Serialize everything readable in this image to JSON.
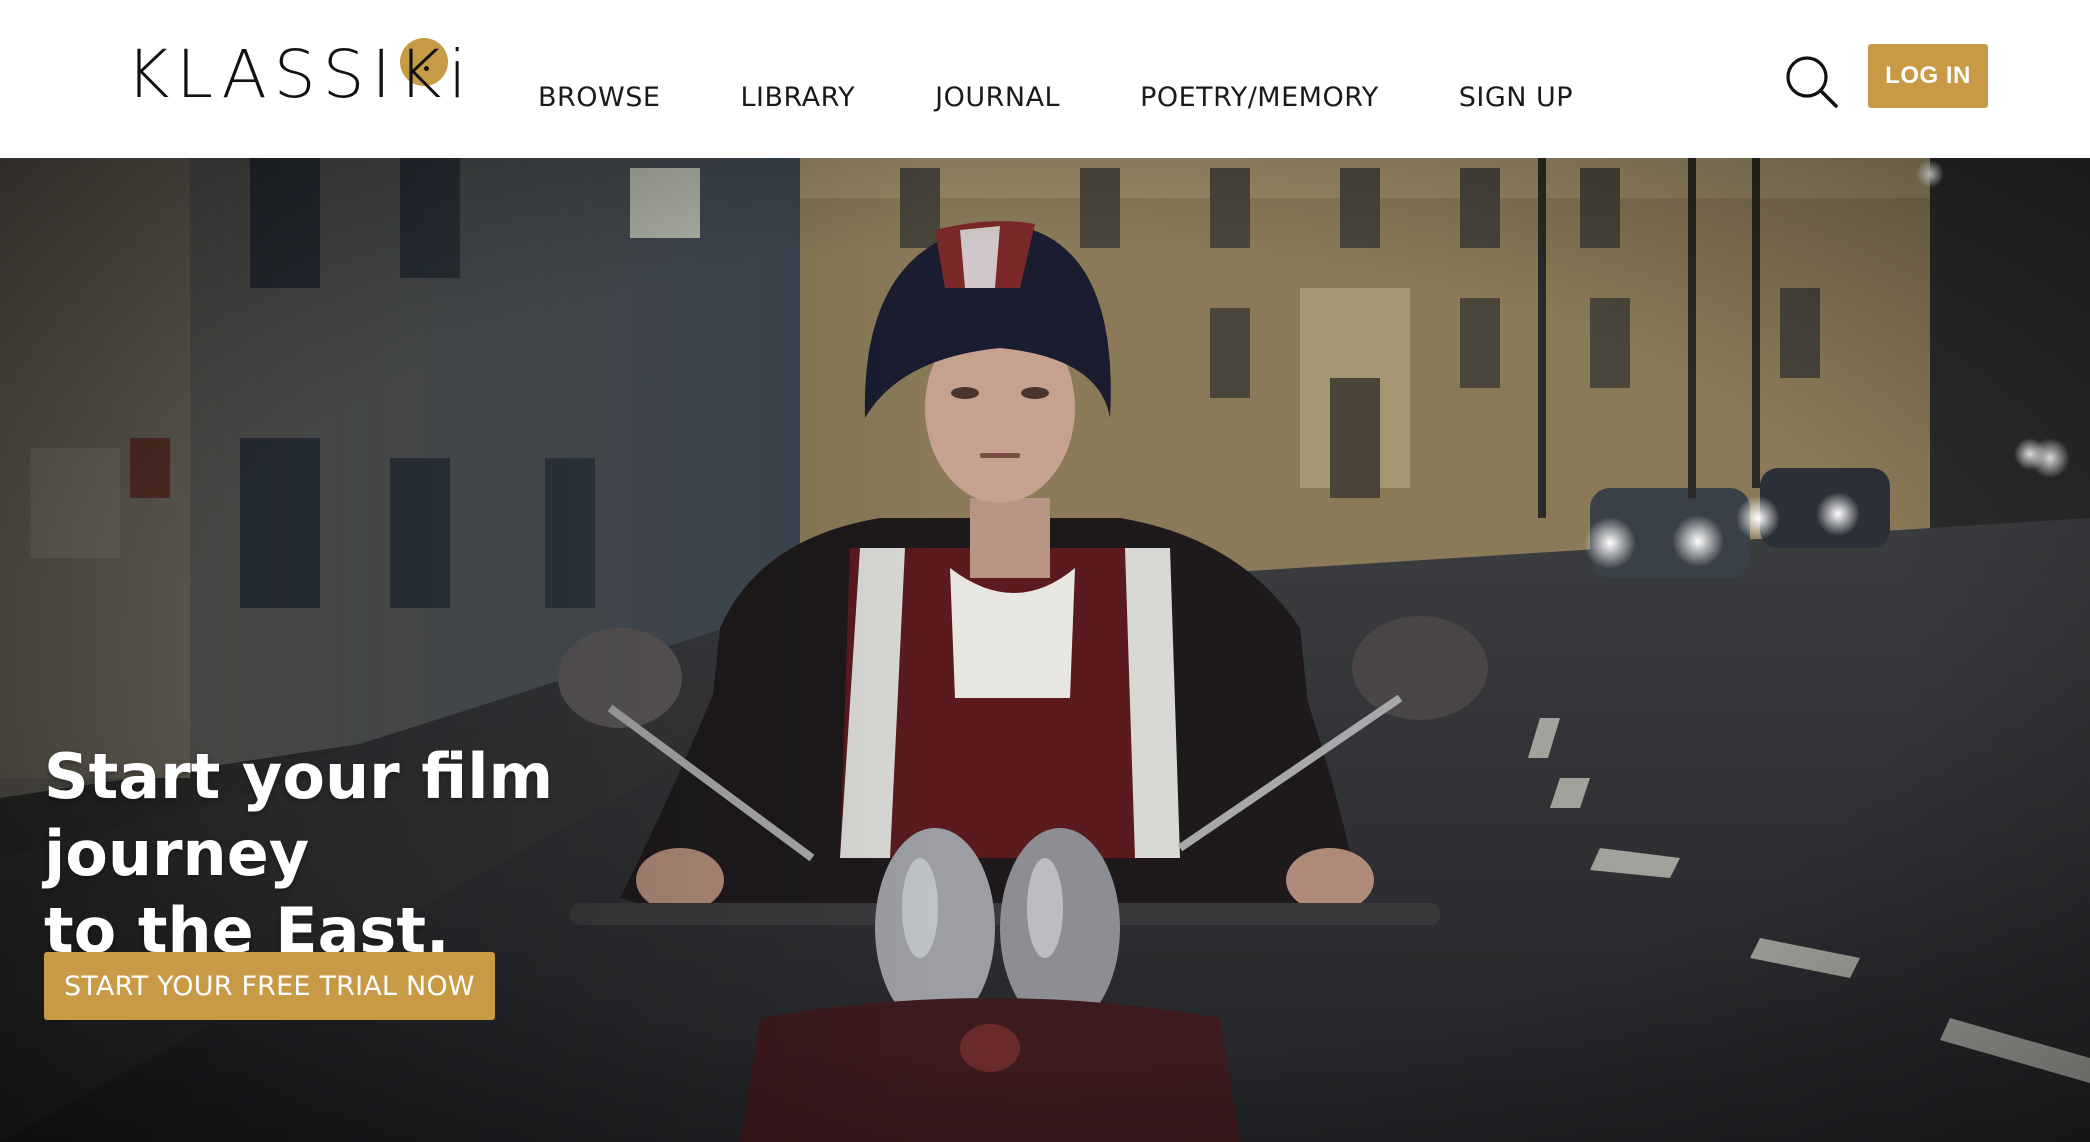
{
  "brand": {
    "logo_text": "KLASSIKi",
    "accent_color": "#c99a45"
  },
  "nav": {
    "items": [
      {
        "label": "BROWSE"
      },
      {
        "label": "LIBRARY"
      },
      {
        "label": "JOURNAL"
      },
      {
        "label": "POETRY/MEMORY"
      },
      {
        "label": "SIGN UP"
      }
    ],
    "search_icon": "search-icon",
    "login_label": "LOG IN"
  },
  "hero": {
    "title_line1": "Start your film journey",
    "title_line2": "to the East.",
    "cta_label": "START YOUR FREE TRIAL NOW",
    "image_subject": "night-street-scooter-rider"
  }
}
